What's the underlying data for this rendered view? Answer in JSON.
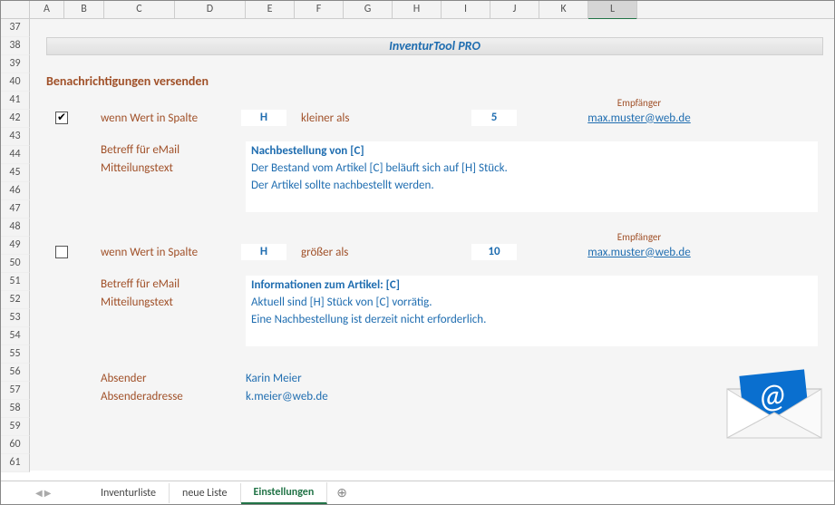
{
  "columns": [
    "A",
    "B",
    "C",
    "D",
    "E",
    "F",
    "G",
    "H",
    "I",
    "J",
    "K",
    "L"
  ],
  "rows": [
    37,
    38,
    39,
    40,
    41,
    42,
    43,
    44,
    45,
    46,
    47,
    48,
    49,
    50,
    51,
    52,
    53,
    54,
    55,
    56,
    57,
    58,
    59,
    60,
    61
  ],
  "title": "InventurTool PRO",
  "section_heading": "Benachrichtigungen versenden",
  "rule1": {
    "checked": true,
    "label_when": "wenn Wert in Spalte",
    "column": "H",
    "comparator": "kleiner als",
    "value": "5",
    "recipient_label": "Empfänger",
    "recipient": "max.muster@web.de",
    "subject_label": "Betreff für eMail",
    "body_label": "Mitteilungstext",
    "subject": "Nachbestellung von [C]",
    "body_line1": "Der Bestand vom Artikel [C] beläuft sich auf [H] Stück.",
    "body_line2": "Der Artikel sollte nachbestellt werden."
  },
  "rule2": {
    "checked": false,
    "label_when": "wenn Wert in Spalte",
    "column": "H",
    "comparator": "größer als",
    "value": "10",
    "recipient_label": "Empfänger",
    "recipient": "max.muster@web.de",
    "subject_label": "Betreff für eMail",
    "body_label": "Mitteilungstext",
    "subject": "Informationen zum Artikel: [C]",
    "body_line1": "Aktuell sind [H] Stück von [C] vorrätig.",
    "body_line2": "Eine Nachbestellung ist derzeit nicht erforderlich."
  },
  "sender": {
    "label_name": "Absender",
    "label_addr": "Absenderadresse",
    "name": "Karin Meier",
    "addr": "k.meier@web.de"
  },
  "tabs": {
    "items": [
      "Inventurliste",
      "neue Liste",
      "Einstellungen"
    ],
    "active": 2,
    "add": "⊕"
  }
}
